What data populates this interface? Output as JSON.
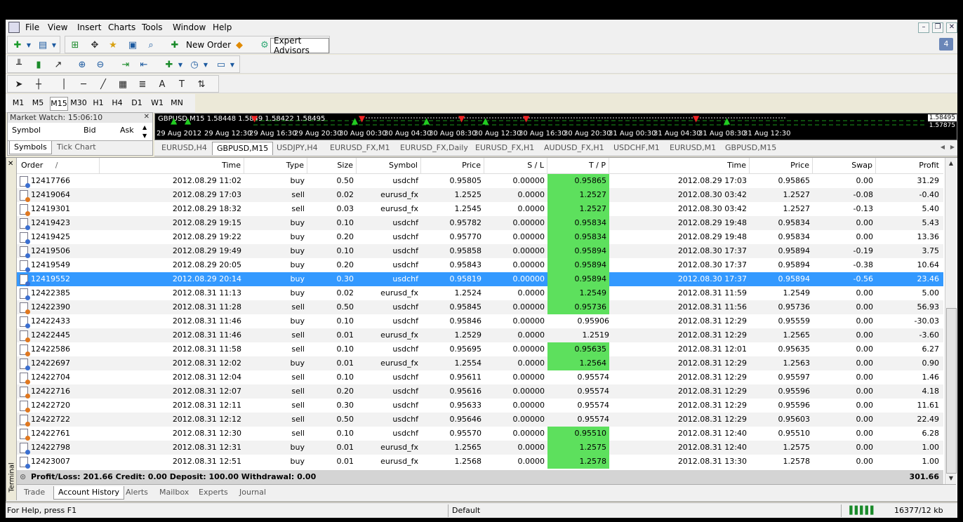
{
  "menu": [
    "File",
    "View",
    "Insert",
    "Charts",
    "Tools",
    "Window",
    "Help"
  ],
  "toolbar1": {
    "new_order": "New Order",
    "expert_advisors": "Expert Advisors",
    "badge": "4"
  },
  "timeframes": [
    "M1",
    "M5",
    "M15",
    "M30",
    "H1",
    "H4",
    "D1",
    "W1",
    "MN"
  ],
  "market_watch": {
    "title": "Market Watch: 15:06:10",
    "col_symbol": "Symbol",
    "col_bid": "Bid",
    "col_ask": "Ask",
    "tab_symbols": "Symbols",
    "tab_tick": "Tick Chart"
  },
  "chart": {
    "info": "GBPUSD,M15  1.58448 1.5849 1.58422 1.58495",
    "price_hi": "1.58495",
    "price_lo": "1.57875",
    "times": [
      "29 Aug 2012",
      "29 Aug 12:30",
      "29 Aug 16:30",
      "29 Aug 20:30",
      "30 Aug 00:30",
      "30 Aug 04:30",
      "30 Aug 08:30",
      "30 Aug 12:30",
      "30 Aug 16:30",
      "30 Aug 20:30",
      "31 Aug 00:30",
      "31 Aug 04:30",
      "31 Aug 08:30",
      "31 Aug 12:30"
    ]
  },
  "chart_tabs": [
    "EURUSD,H4",
    "GBPUSD,M15",
    "USDJPY,H4",
    "EURUSD_FX,M1",
    "EURUSD_FX,Daily",
    "EURUSD_FX,H1",
    "AUDUSD_FX,H1",
    "USDCHF,M1",
    "EURUSD,M1",
    "GBPUSD,M15"
  ],
  "columns": [
    "Order",
    "/",
    "Time",
    "Type",
    "Size",
    "Symbol",
    "Price",
    "S / L",
    "T / P",
    "Time",
    "Price",
    "Swap",
    "Profit"
  ],
  "trades": [
    [
      "12417766",
      "2012.08.29 11:02",
      "buy",
      "0.50",
      "usdchf",
      "0.95805",
      "0.00000",
      "0.95865",
      "2012.08.29 17:03",
      "0.95865",
      "0.00",
      "31.29"
    ],
    [
      "12419064",
      "2012.08.29 17:03",
      "sell",
      "0.02",
      "eurusd_fx",
      "1.2525",
      "0.0000",
      "1.2527",
      "2012.08.30 03:42",
      "1.2527",
      "-0.08",
      "-0.40"
    ],
    [
      "12419301",
      "2012.08.29 18:32",
      "sell",
      "0.03",
      "eurusd_fx",
      "1.2545",
      "0.0000",
      "1.2527",
      "2012.08.30 03:42",
      "1.2527",
      "-0.13",
      "5.40"
    ],
    [
      "12419423",
      "2012.08.29 19:15",
      "buy",
      "0.10",
      "usdchf",
      "0.95782",
      "0.00000",
      "0.95834",
      "2012.08.29 19:48",
      "0.95834",
      "0.00",
      "5.43"
    ],
    [
      "12419425",
      "2012.08.29 19:22",
      "buy",
      "0.20",
      "usdchf",
      "0.95770",
      "0.00000",
      "0.95834",
      "2012.08.29 19:48",
      "0.95834",
      "0.00",
      "13.36"
    ],
    [
      "12419506",
      "2012.08.29 19:49",
      "buy",
      "0.10",
      "usdchf",
      "0.95858",
      "0.00000",
      "0.95894",
      "2012.08.30 17:37",
      "0.95894",
      "-0.19",
      "3.75"
    ],
    [
      "12419549",
      "2012.08.29 20:05",
      "buy",
      "0.20",
      "usdchf",
      "0.95843",
      "0.00000",
      "0.95894",
      "2012.08.30 17:37",
      "0.95894",
      "-0.38",
      "10.64"
    ],
    [
      "12419552",
      "2012.08.29 20:14",
      "buy",
      "0.30",
      "usdchf",
      "0.95819",
      "0.00000",
      "0.95894",
      "2012.08.30 17:37",
      "0.95894",
      "-0.56",
      "23.46"
    ],
    [
      "12422385",
      "2012.08.31 11:13",
      "buy",
      "0.02",
      "eurusd_fx",
      "1.2524",
      "0.0000",
      "1.2549",
      "2012.08.31 11:59",
      "1.2549",
      "0.00",
      "5.00"
    ],
    [
      "12422390",
      "2012.08.31 11:28",
      "sell",
      "0.50",
      "usdchf",
      "0.95845",
      "0.00000",
      "0.95736",
      "2012.08.31 11:56",
      "0.95736",
      "0.00",
      "56.93"
    ],
    [
      "12422433",
      "2012.08.31 11:46",
      "buy",
      "0.10",
      "usdchf",
      "0.95846",
      "0.00000",
      "0.95906",
      "2012.08.31 12:29",
      "0.95559",
      "0.00",
      "-30.03"
    ],
    [
      "12422445",
      "2012.08.31 11:46",
      "sell",
      "0.01",
      "eurusd_fx",
      "1.2529",
      "0.0000",
      "1.2519",
      "2012.08.31 12:29",
      "1.2565",
      "0.00",
      "-3.60"
    ],
    [
      "12422586",
      "2012.08.31 11:58",
      "sell",
      "0.10",
      "usdchf",
      "0.95695",
      "0.00000",
      "0.95635",
      "2012.08.31 12:01",
      "0.95635",
      "0.00",
      "6.27"
    ],
    [
      "12422697",
      "2012.08.31 12:02",
      "buy",
      "0.01",
      "eurusd_fx",
      "1.2554",
      "0.0000",
      "1.2564",
      "2012.08.31 12:29",
      "1.2563",
      "0.00",
      "0.90"
    ],
    [
      "12422704",
      "2012.08.31 12:04",
      "sell",
      "0.10",
      "usdchf",
      "0.95611",
      "0.00000",
      "0.95574",
      "2012.08.31 12:29",
      "0.95597",
      "0.00",
      "1.46"
    ],
    [
      "12422716",
      "2012.08.31 12:07",
      "sell",
      "0.20",
      "usdchf",
      "0.95616",
      "0.00000",
      "0.95574",
      "2012.08.31 12:29",
      "0.95596",
      "0.00",
      "4.18"
    ],
    [
      "12422720",
      "2012.08.31 12:11",
      "sell",
      "0.30",
      "usdchf",
      "0.95633",
      "0.00000",
      "0.95574",
      "2012.08.31 12:29",
      "0.95596",
      "0.00",
      "11.61"
    ],
    [
      "12422722",
      "2012.08.31 12:12",
      "sell",
      "0.50",
      "usdchf",
      "0.95646",
      "0.00000",
      "0.95574",
      "2012.08.31 12:29",
      "0.95603",
      "0.00",
      "22.49"
    ],
    [
      "12422761",
      "2012.08.31 12:30",
      "sell",
      "0.10",
      "usdchf",
      "0.95570",
      "0.00000",
      "0.95510",
      "2012.08.31 12:40",
      "0.95510",
      "0.00",
      "6.28"
    ],
    [
      "12422798",
      "2012.08.31 12:31",
      "buy",
      "0.01",
      "eurusd_fx",
      "1.2565",
      "0.0000",
      "1.2575",
      "2012.08.31 12:40",
      "1.2575",
      "0.00",
      "1.00"
    ],
    [
      "12423007",
      "2012.08.31 12:51",
      "buy",
      "0.01",
      "eurusd_fx",
      "1.2568",
      "0.0000",
      "1.2578",
      "2012.08.31 13:30",
      "1.2578",
      "0.00",
      "1.00"
    ]
  ],
  "selected_row": 7,
  "tp_highlight_rows": [
    0,
    1,
    2,
    3,
    4,
    5,
    6,
    7,
    8,
    9,
    12,
    13,
    18,
    19,
    20
  ],
  "summary": {
    "text": "Profit/Loss: 201.66  Credit: 0.00  Deposit: 100.00  Withdrawal: 0.00",
    "total": "301.66"
  },
  "bottom_tabs": [
    "Trade",
    "Account History",
    "Alerts",
    "Mailbox",
    "Experts",
    "Journal"
  ],
  "terminal_label": "Terminal",
  "status": {
    "help": "For Help, press F1",
    "profile": "Default",
    "traffic": "16377/12 kb"
  },
  "colors": {
    "tp_highlight": "#5de05d",
    "selected": "#3399ff",
    "buy_dot": "#3b6fd0",
    "sell_dot": "#e07820"
  }
}
